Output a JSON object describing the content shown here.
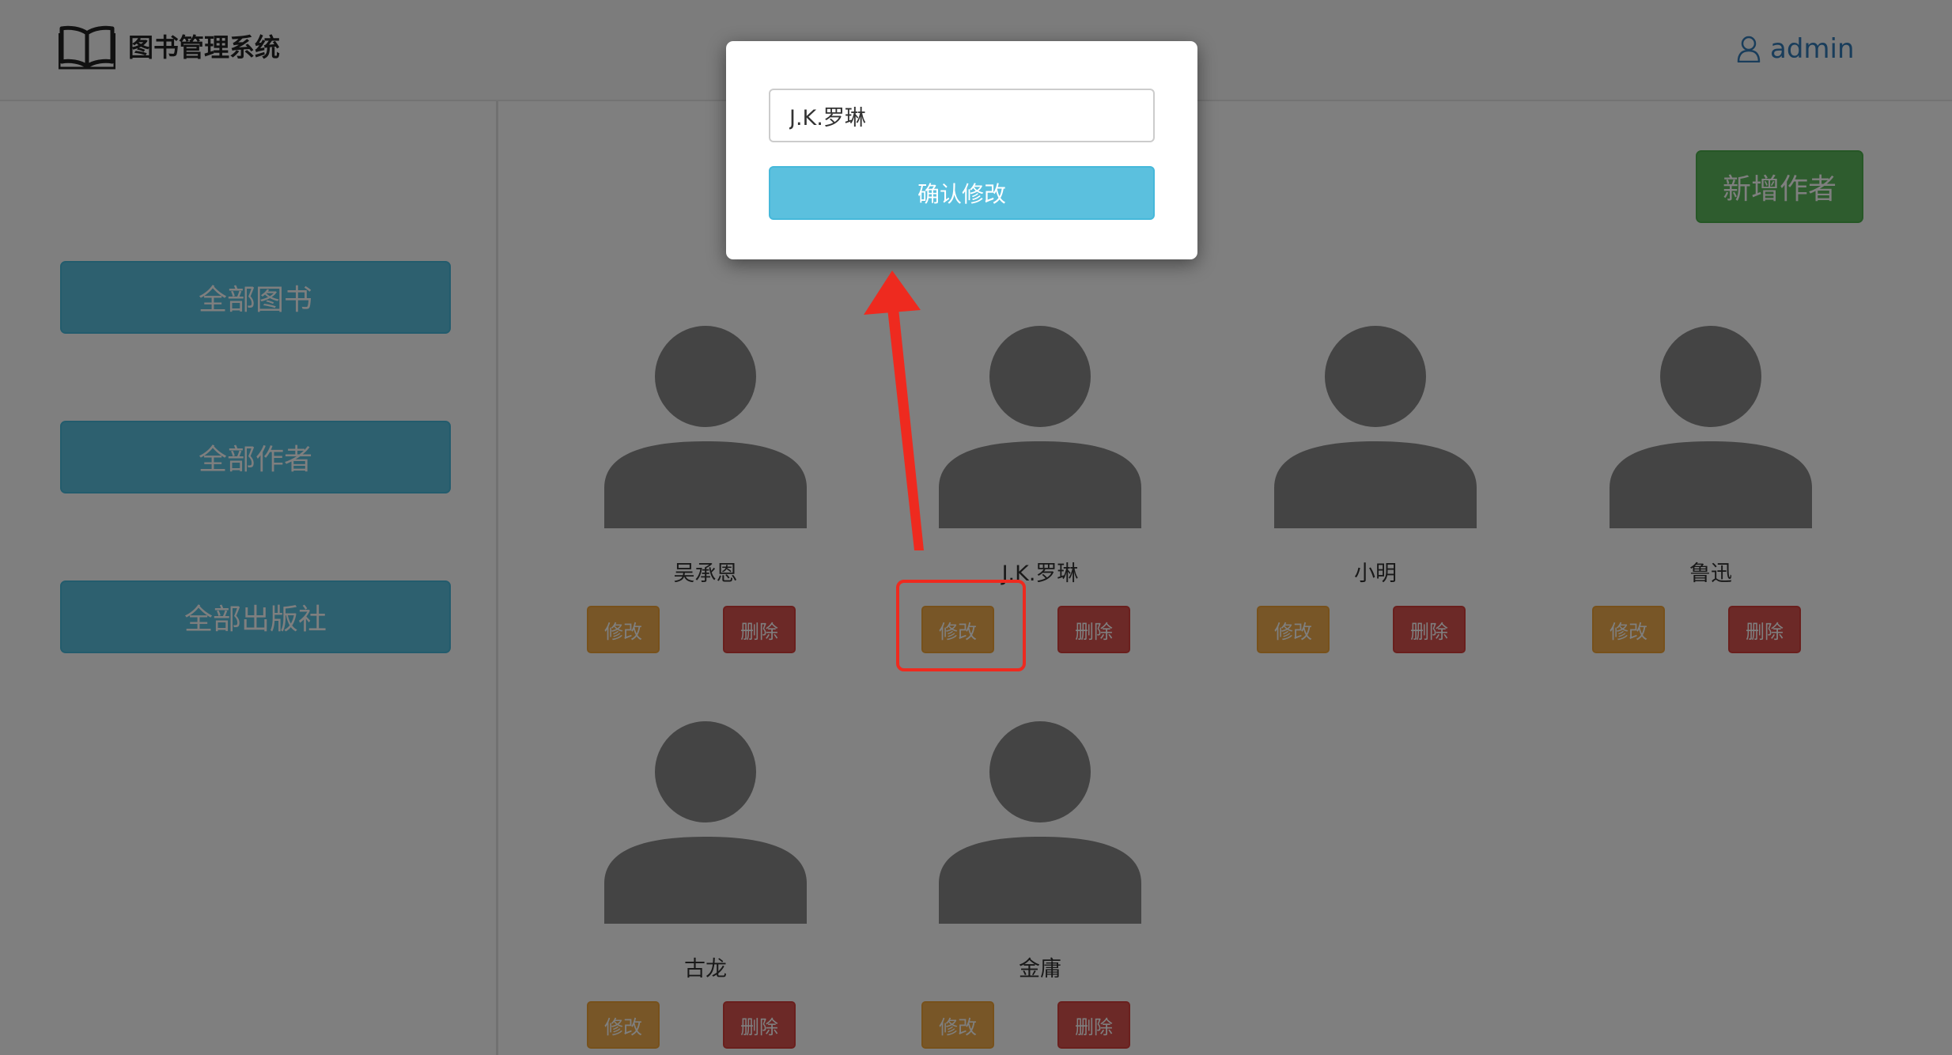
{
  "header": {
    "app_title": "图书管理系统",
    "logo_icon": "open-book-icon",
    "user_icon": "user-icon",
    "username": "admin"
  },
  "sidebar": {
    "items": [
      {
        "label": "全部图书"
      },
      {
        "label": "全部作者"
      },
      {
        "label": "全部出版社"
      }
    ]
  },
  "main": {
    "add_author_label": "新增作者",
    "authors": [
      {
        "name": "吴承恩",
        "edit_label": "修改",
        "delete_label": "删除"
      },
      {
        "name": "J.K.罗琳",
        "edit_label": "修改",
        "delete_label": "删除"
      },
      {
        "name": "小明",
        "edit_label": "修改",
        "delete_label": "删除"
      },
      {
        "name": "鲁迅",
        "edit_label": "修改",
        "delete_label": "删除"
      },
      {
        "name": "古龙",
        "edit_label": "修改",
        "delete_label": "删除"
      },
      {
        "name": "金庸",
        "edit_label": "修改",
        "delete_label": "删除"
      }
    ]
  },
  "modal": {
    "input_value": "J.K.罗琳",
    "confirm_label": "确认修改"
  },
  "colors": {
    "info": "#5bc0de",
    "success": "#5cb85c",
    "warning": "#f0ad4e",
    "danger": "#d9534f",
    "annotation_red": "#ee2a1f",
    "link_blue": "#337ab7"
  }
}
